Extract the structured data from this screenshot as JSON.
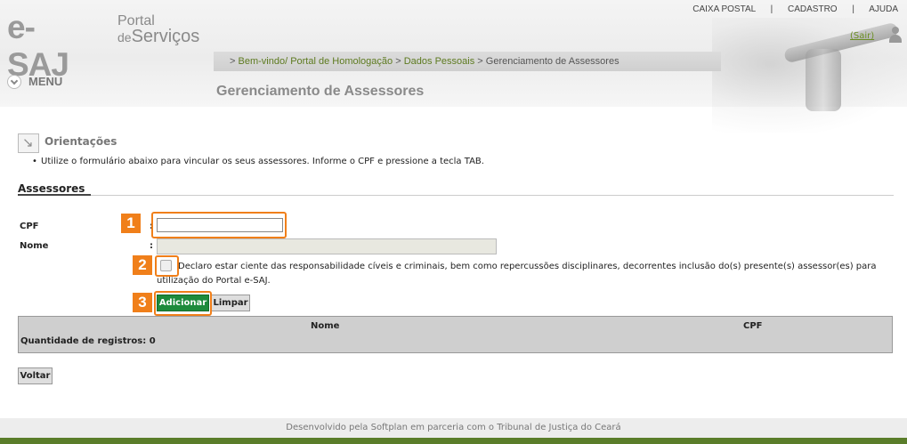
{
  "header": {
    "logo_esaj": "e-SAJ",
    "logo_portal": "Portal",
    "logo_de": "de",
    "logo_servicos": "Serviços",
    "nav": [
      "CAIXA POSTAL",
      "CADASTRO",
      "AJUDA"
    ],
    "nav_sep": "|",
    "sair": "(Sair)"
  },
  "breadcrumb": {
    "prefix": ">",
    "items": [
      "Bem-vindo/ Portal de Homologação",
      "Dados Pessoais"
    ],
    "sep": ">",
    "current": "Gerenciamento de Assessores"
  },
  "menu": {
    "label": "MENU"
  },
  "page_title": "Gerenciamento de Assessores",
  "orientacoes": {
    "title": "Orientações",
    "text": "Utilize o formulário abaixo para vincular os seus assessores. Informe o CPF e pressione a tecla TAB."
  },
  "assessores": {
    "title": "Assessores",
    "cpf_label": "CPF",
    "nome_label": "Nome",
    "colon": ":",
    "cpf_value": "",
    "nome_value": "",
    "declaration": "Declaro estar ciente das responsabilidade cíveis e criminais, bem como repercussões disciplinares, decorrentes inclusão do(s) presente(s) assessor(es) para utilização do Portal e-SAJ.",
    "btn_add": "Adicionar",
    "btn_clear": "Limpar"
  },
  "badges": [
    "1",
    "2",
    "3"
  ],
  "grid": {
    "columns": [
      "Nome",
      "CPF"
    ],
    "count_label": "Quantidade de registros: 0"
  },
  "btn_back": "Voltar",
  "footer": "Desenvolvido pela Softplan em parceria com o Tribunal de Justiça do Ceará",
  "colors": {
    "accent": "#f07f1a",
    "green_button": "#1e8b3c",
    "link": "#5d7a1f"
  }
}
